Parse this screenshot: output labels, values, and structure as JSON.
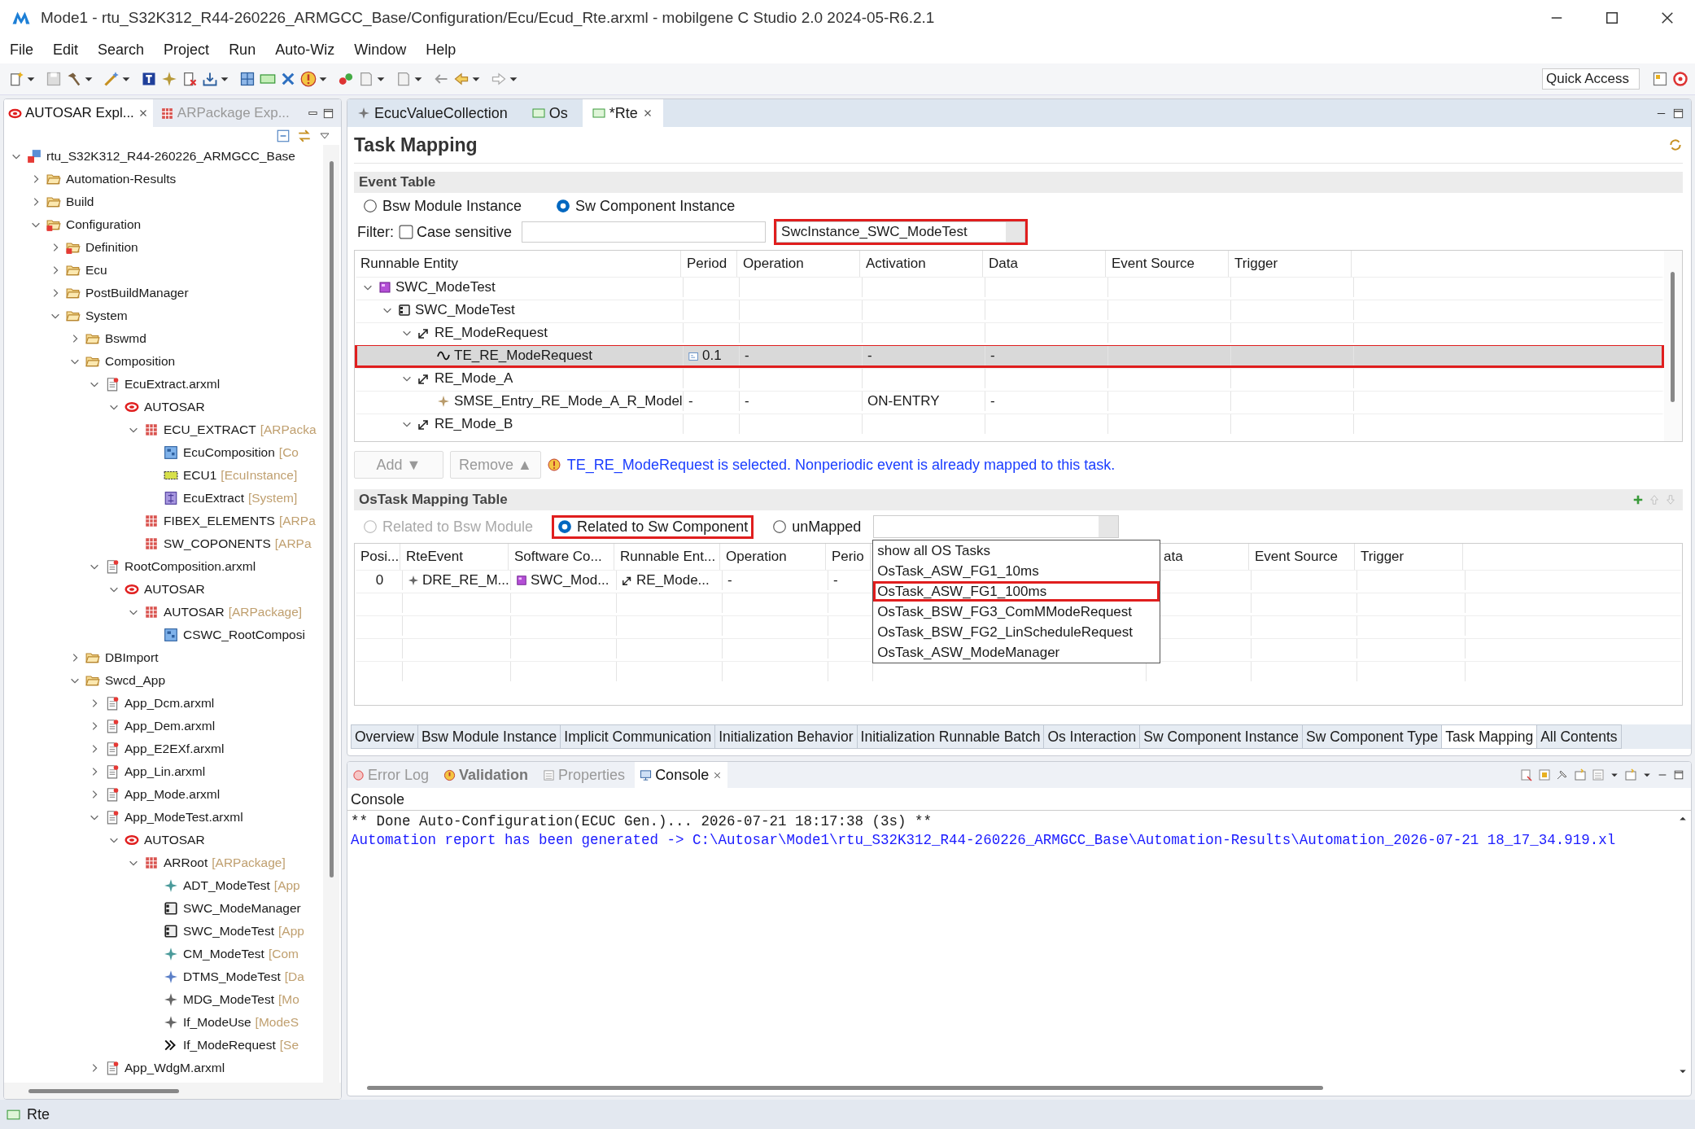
{
  "window": {
    "title": "Mode1 - rtu_S32K312_R44-260226_ARMGCC_Base/Configuration/Ecu/Ecud_Rte.arxml - mobilgene C Studio 2.0 2024-05-R6.2.1"
  },
  "menu": [
    "File",
    "Edit",
    "Search",
    "Project",
    "Run",
    "Auto-Wiz",
    "Window",
    "Help"
  ],
  "toolbar": {
    "quick_access": {
      "placeholder": "Quick Access"
    }
  },
  "explorer": {
    "tabs": [
      {
        "label": "AUTOSAR Expl...",
        "kind": "autosar",
        "selected": true
      },
      {
        "label": "ARPackage Exp...",
        "kind": "package",
        "selected": false
      }
    ],
    "tree": [
      {
        "label": "rtu_S32K312_R44-260226_ARMGCC_Base",
        "kind": "project",
        "expanded": true,
        "children": [
          {
            "label": "Automation-Results",
            "kind": "folder",
            "expanded": false
          },
          {
            "label": "Build",
            "kind": "folder",
            "expanded": false
          },
          {
            "label": "Configuration",
            "kind": "cfolder",
            "expanded": true,
            "children": [
              {
                "label": "Definition",
                "kind": "cfolder",
                "expanded": false
              },
              {
                "label": "Ecu",
                "kind": "folder",
                "expanded": false
              },
              {
                "label": "PostBuildManager",
                "kind": "folder",
                "expanded": false
              },
              {
                "label": "System",
                "kind": "folder",
                "expanded": true,
                "children": [
                  {
                    "label": "Bswmd",
                    "kind": "folder",
                    "expanded": false
                  },
                  {
                    "label": "Composition",
                    "kind": "folder",
                    "expanded": true,
                    "children": [
                      {
                        "label": "EcuExtract.arxml",
                        "kind": "file",
                        "expanded": true,
                        "children": [
                          {
                            "label": "AUTOSAR",
                            "kind": "autosar",
                            "expanded": true,
                            "children": [
                              {
                                "label": "ECU_EXTRACT",
                                "type": "[ARPacka",
                                "kind": "package",
                                "expanded": true,
                                "children": [
                                  {
                                    "label": "EcuComposition",
                                    "type": "[Co",
                                    "kind": "composition"
                                  },
                                  {
                                    "label": "ECU1",
                                    "type": "[EcuInstance]",
                                    "kind": "ecu"
                                  },
                                  {
                                    "label": "EcuExtract",
                                    "type": "[System]",
                                    "kind": "system"
                                  }
                                ]
                              },
                              {
                                "label": "FIBEX_ELEMENTS",
                                "type": "[ARPa",
                                "kind": "package"
                              },
                              {
                                "label": "SW_COPONENTS",
                                "type": "[ARPa",
                                "kind": "package"
                              }
                            ]
                          }
                        ]
                      },
                      {
                        "label": "RootComposition.arxml",
                        "kind": "file",
                        "expanded": true,
                        "children": [
                          {
                            "label": "AUTOSAR",
                            "kind": "autosar",
                            "expanded": true,
                            "children": [
                              {
                                "label": "AUTOSAR",
                                "type": "[ARPackage]",
                                "kind": "package",
                                "expanded": true,
                                "children": [
                                  {
                                    "label": "CSWC_RootComposi",
                                    "kind": "composition"
                                  }
                                ]
                              }
                            ]
                          }
                        ]
                      }
                    ]
                  },
                  {
                    "label": "DBImport",
                    "kind": "folder",
                    "expanded": false
                  },
                  {
                    "label": "Swcd_App",
                    "kind": "folder",
                    "expanded": true,
                    "children": [
                      {
                        "label": "App_Dcm.arxml",
                        "kind": "file",
                        "expanded": false
                      },
                      {
                        "label": "App_Dem.arxml",
                        "kind": "file",
                        "expanded": false
                      },
                      {
                        "label": "App_E2EXf.arxml",
                        "kind": "file",
                        "expanded": false
                      },
                      {
                        "label": "App_Lin.arxml",
                        "kind": "file",
                        "expanded": false
                      },
                      {
                        "label": "App_Mode.arxml",
                        "kind": "file",
                        "expanded": false
                      },
                      {
                        "label": "App_ModeTest.arxml",
                        "kind": "file",
                        "expanded": true,
                        "children": [
                          {
                            "label": "AUTOSAR",
                            "kind": "autosar",
                            "expanded": true,
                            "children": [
                              {
                                "label": "ARRoot",
                                "type": "[ARPackage]",
                                "kind": "package",
                                "expanded": true,
                                "children": [
                                  {
                                    "label": "ADT_ModeTest",
                                    "type": "[App",
                                    "kind": "star-teal"
                                  },
                                  {
                                    "label": "SWC_ModeManager",
                                    "kind": "component"
                                  },
                                  {
                                    "label": "SWC_ModeTest",
                                    "type": "[App",
                                    "kind": "component"
                                  },
                                  {
                                    "label": "CM_ModeTest",
                                    "type": "[Com",
                                    "kind": "star-teal"
                                  },
                                  {
                                    "label": "DTMS_ModeTest",
                                    "type": "[Da",
                                    "kind": "star-blue"
                                  },
                                  {
                                    "label": "MDG_ModeTest",
                                    "type": "[Mo",
                                    "kind": "star-grey"
                                  },
                                  {
                                    "label": "If_ModeUse",
                                    "type": "[ModeS",
                                    "kind": "star-grey"
                                  },
                                  {
                                    "label": "If_ModeRequest",
                                    "type": "[Se",
                                    "kind": "interface"
                                  }
                                ]
                              }
                            ]
                          }
                        ]
                      },
                      {
                        "label": "App_WdgM.arxml",
                        "kind": "file",
                        "expanded": false
                      }
                    ]
                  }
                ]
              }
            ]
          }
        ]
      }
    ]
  },
  "editor": {
    "tabs": [
      {
        "label": "EcucValueCollection",
        "kind": "ecuc",
        "selected": false
      },
      {
        "label": "Os",
        "kind": "module",
        "selected": false
      },
      {
        "label": "*Rte",
        "kind": "module",
        "selected": true
      }
    ],
    "title": "Task Mapping",
    "event_table": {
      "title": "Event Table",
      "modes": [
        {
          "label": "Bsw Module Instance",
          "selected": false
        },
        {
          "label": "Sw Component Instance",
          "selected": true
        }
      ],
      "filter": {
        "label": "Filter:",
        "case_sensitive": {
          "label": "Case sensitive",
          "checked": false
        },
        "instance": {
          "value": "SwcInstance_SWC_ModeTest",
          "highlighted": true
        }
      },
      "columns": [
        "Runnable Entity",
        "Period",
        "Operation",
        "Activation",
        "Data",
        "Event Source",
        "Trigger"
      ],
      "rows": [
        {
          "name": "SWC_ModeTest",
          "kind": "swc-inst",
          "selected": false,
          "expanded": true,
          "children": [
            {
              "name": "SWC_ModeTest",
              "kind": "component",
              "selected": false,
              "expanded": true,
              "children": [
                {
                  "name": "RE_ModeRequest",
                  "kind": "runnable",
                  "selected": false,
                  "expanded": true,
                  "children": [
                    {
                      "name": "TE_RE_ModeRequest",
                      "kind": "wave",
                      "selected": true,
                      "highlighted": true,
                      "cells": [
                        "0.1",
                        "-",
                        "-",
                        "-"
                      ]
                    }
                  ]
                },
                {
                  "name": "RE_Mode_A",
                  "kind": "runnable",
                  "selected": false,
                  "expanded": true,
                  "children": [
                    {
                      "name": "SMSE_Entry_RE_Mode_A_R_Model",
                      "kind": "star-tan",
                      "selected": false,
                      "cells": [
                        "-",
                        "-",
                        "ON-ENTRY",
                        "-"
                      ]
                    }
                  ]
                },
                {
                  "name": "RE_Mode_B",
                  "kind": "runnable",
                  "selected": false,
                  "expanded": true
                }
              ]
            }
          ]
        }
      ]
    },
    "actions": {
      "buttons": [
        {
          "label": "Add",
          "arrow": "▼",
          "disabled": true
        },
        {
          "label": "Remove",
          "arrow": "▲",
          "disabled": true
        }
      ],
      "message": "TE_RE_ModeRequest is selected. Nonperiodic event is already mapped to this task."
    },
    "os_task_mapping": {
      "title": "OsTask Mapping Table",
      "filters": [
        {
          "label": "Related to Bsw Module",
          "selected": false,
          "disabled": true,
          "highlighted": false
        },
        {
          "label": "Related to Sw Component",
          "selected": true,
          "disabled": false,
          "highlighted": true
        },
        {
          "label": "unMapped",
          "selected": false,
          "disabled": false,
          "highlighted": false
        }
      ],
      "task_options": [
        {
          "label": "show all OS Tasks",
          "highlighted": false
        },
        {
          "label": "OsTask_ASW_FG1_10ms",
          "highlighted": false
        },
        {
          "label": "OsTask_ASW_FG1_100ms",
          "highlighted": true
        },
        {
          "label": "OsTask_BSW_FG3_ComMModeRequest",
          "highlighted": false
        },
        {
          "label": "OsTask_BSW_FG2_LinScheduleRequest",
          "highlighted": false
        },
        {
          "label": "OsTask_ASW_ModeManager",
          "highlighted": false
        }
      ],
      "columns": [
        "Posi...",
        "RteEvent",
        "Software Co...",
        "Runnable Ent...",
        "Operation",
        "Perio",
        "ata",
        "Event Source",
        "Trigger"
      ],
      "rows": [
        {
          "cells": [
            {
              "text": "0"
            },
            {
              "text": "DRE_RE_M...",
              "kind": "star-grey"
            },
            {
              "text": "SWC_Mod...",
              "kind": "swc-inst"
            },
            {
              "text": "RE_Mode...",
              "kind": "runnable"
            },
            {
              "text": "-"
            },
            {
              "text": "-"
            }
          ]
        }
      ]
    },
    "page_tabs": [
      {
        "label": "Overview",
        "selected": false
      },
      {
        "label": "Bsw Module Instance",
        "selected": false
      },
      {
        "label": "Implicit Communication",
        "selected": false
      },
      {
        "label": "Initialization Behavior",
        "selected": false
      },
      {
        "label": "Initialization Runnable Batch",
        "selected": false
      },
      {
        "label": "Os Interaction",
        "selected": false
      },
      {
        "label": "Sw Component Instance",
        "selected": false
      },
      {
        "label": "Sw Component Type",
        "selected": false
      },
      {
        "label": "Task Mapping",
        "selected": true
      },
      {
        "label": "All Contents",
        "selected": false
      }
    ]
  },
  "console": {
    "tabs": [
      {
        "label": "Error Log",
        "kind": "errorlog",
        "selected": false,
        "updated": false
      },
      {
        "label": "Validation",
        "kind": "validation",
        "selected": false,
        "updated": true
      },
      {
        "label": "Properties",
        "kind": "properties",
        "selected": false,
        "updated": false
      },
      {
        "label": "Console",
        "kind": "console",
        "selected": true,
        "updated": false
      }
    ],
    "title": "Console",
    "lines": [
      {
        "text": "** Done Auto-Configuration(ECUC Gen.)... 2026-07-21 18:17:38 (3s) **",
        "kind": "output"
      },
      {
        "text": "Automation report has been generated -> C:\\Autosar\\Mode1\\rtu_S32K312_R44-260226_ARMGCC_Base\\Automation-Results\\Automation_2026-07-21 18_17_34.919.xl",
        "kind": "link"
      }
    ]
  },
  "status_bar": {
    "text": "Rte"
  }
}
